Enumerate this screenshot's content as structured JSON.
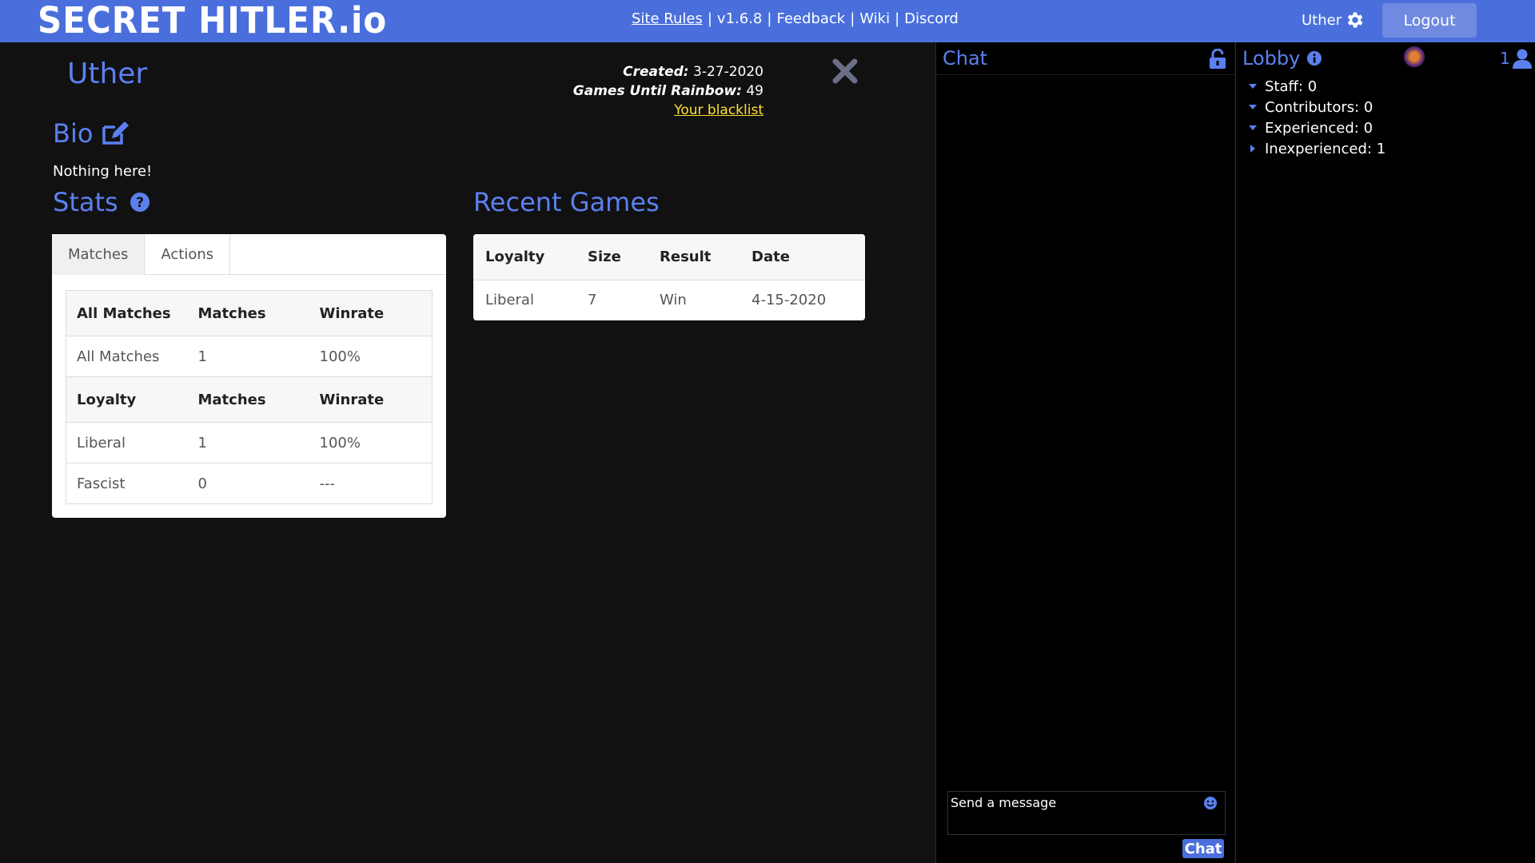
{
  "header": {
    "logo": "SECRET HITLER.io",
    "links": [
      {
        "label": "Site Rules",
        "underline": true
      },
      {
        "label": "v1.6.8",
        "underline": false
      },
      {
        "label": "Feedback",
        "underline": false
      },
      {
        "label": "Wiki",
        "underline": false
      },
      {
        "label": "Discord",
        "underline": false
      }
    ],
    "username": "Uther",
    "logout_label": "Logout"
  },
  "profile": {
    "name": "Uther",
    "created_label": "Created:",
    "created_value": "3-27-2020",
    "rainbow_label": "Games Until Rainbow:",
    "rainbow_value": "49",
    "blacklist_label": "Your blacklist",
    "bio_title": "Bio",
    "bio_text": "Nothing here!",
    "stats_title": "Stats",
    "recent_title": "Recent Games"
  },
  "stats": {
    "tabs": [
      "Matches",
      "Actions"
    ],
    "all_header": [
      "All Matches",
      "Matches",
      "Winrate"
    ],
    "all_row": [
      "All Matches",
      "1",
      "100%"
    ],
    "loyalty_header": [
      "Loyalty",
      "Matches",
      "Winrate"
    ],
    "loyalty_rows": [
      [
        "Liberal",
        "1",
        "100%"
      ],
      [
        "Fascist",
        "0",
        "---"
      ]
    ]
  },
  "recent_games": {
    "headers": [
      "Loyalty",
      "Size",
      "Result",
      "Date"
    ],
    "rows": [
      [
        "Liberal",
        "7",
        "Win",
        "4-15-2020"
      ]
    ]
  },
  "chat": {
    "title": "Chat",
    "placeholder": "Send a message",
    "send_label": "Chat"
  },
  "lobby": {
    "title": "Lobby",
    "count": "1",
    "groups": [
      {
        "label": "Staff: 0",
        "expanded": true
      },
      {
        "label": "Contributors: 0",
        "expanded": true
      },
      {
        "label": "Experienced: 0",
        "expanded": true
      },
      {
        "label": "Inexperienced: 1",
        "expanded": false
      }
    ]
  },
  "colors": {
    "topbar": "#4a6fdc",
    "accent": "#5b80f0",
    "blacklist": "#ffe12e",
    "background": "#111112"
  }
}
